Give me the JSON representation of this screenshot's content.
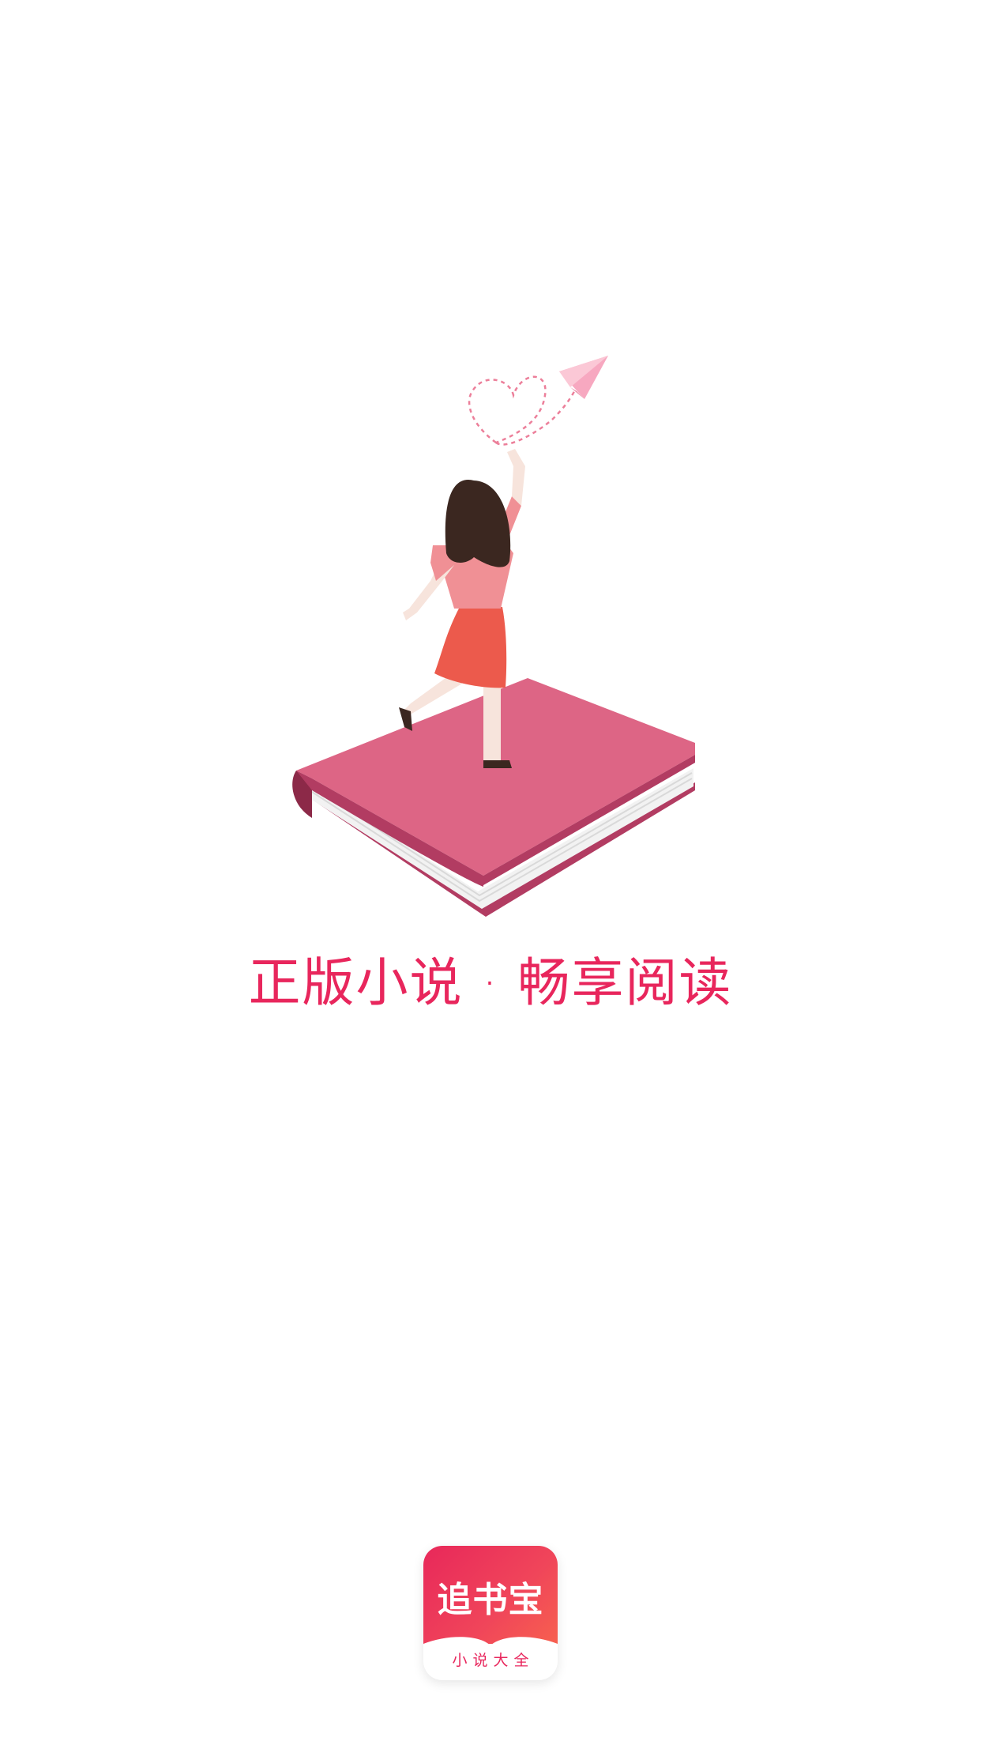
{
  "splash": {
    "slogan": "正版小说 · 畅享阅读",
    "illustration_icon": "girl-on-book-illustration",
    "paper_plane_icon": "paper-plane-icon",
    "heart_trail_icon": "heart-trail-icon"
  },
  "logo": {
    "name": "追书宝",
    "subtitle": "小说大全",
    "icon": "app-logo-icon"
  },
  "colors": {
    "accent": "#e8265c",
    "book_cover": "#dd6585",
    "book_spine": "#b23c62",
    "shirt": "#f09095",
    "skirt": "#ec5a4c",
    "hair": "#3b2720",
    "skin": "#f7e4dc",
    "plane": "#f7a8c0"
  }
}
